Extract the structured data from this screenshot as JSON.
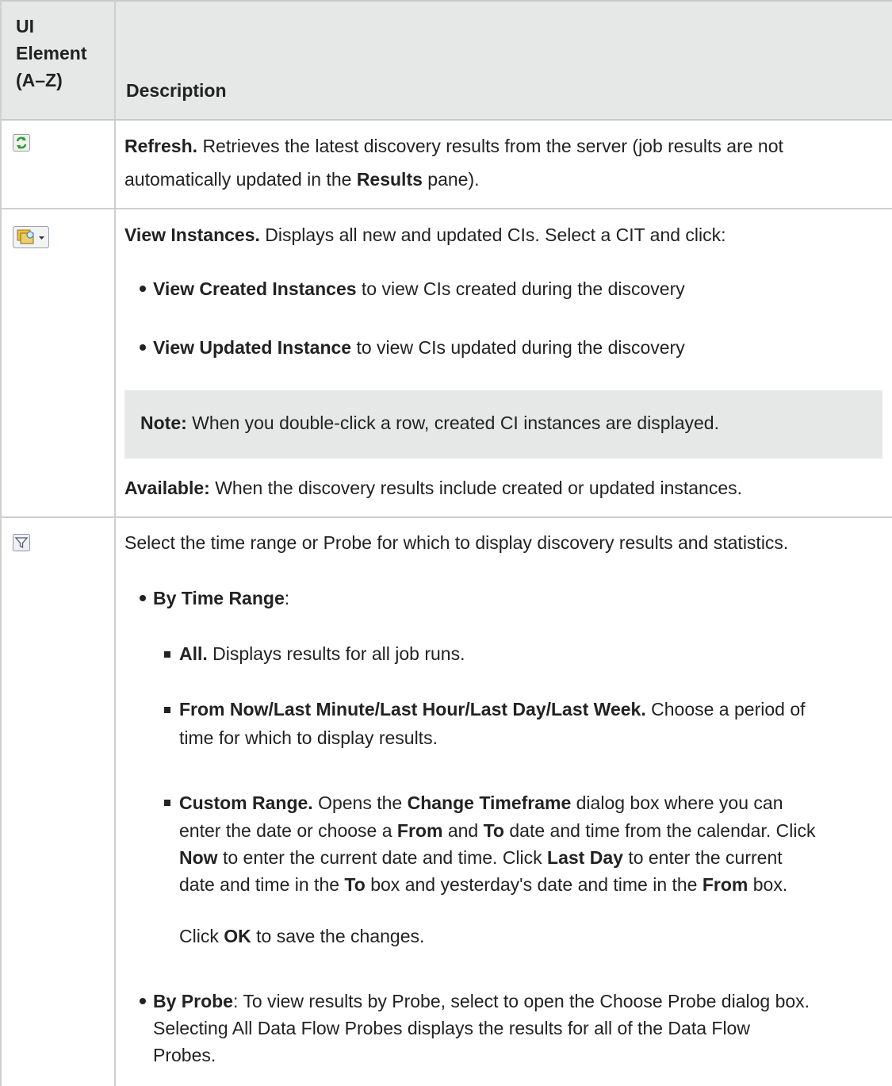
{
  "header": {
    "col1_lines": [
      "UI",
      "Element",
      "(A–Z)"
    ],
    "col2": "Description"
  },
  "rows": {
    "refresh": {
      "icon": "refresh-icon",
      "title": "Refresh.",
      "line1": "Retrieves the latest discovery results from the server (job results are not",
      "line2_pre": "automatically updated in the",
      "line2_bold": "Results",
      "line2_post": "pane)."
    },
    "view_instances": {
      "icon": "view-instances-icon",
      "title": "View Instances.",
      "line1": "Displays all new and updated CIs. Select a CIT and click:",
      "bullet1_bold": "View Created Instances",
      "bullet1_text": "to view CIs created during the discovery",
      "bullet2_bold": "View Updated Instance",
      "bullet2_text": "to view CIs updated during the discovery",
      "note_label": "Note:",
      "note_text": "When you double-click a row, created CI instances are displayed.",
      "available_label": "Available:",
      "available_text": "When the discovery results include created or updated instances."
    },
    "filter": {
      "icon": "filter-icon",
      "intro": "Select the time range or Probe for which to display discovery results and statistics.",
      "by_time_range": "By Time Range",
      "colon": ":",
      "all_bold": "All.",
      "all_text": "Displays results for all job runs.",
      "from_now_bold": "From Now/Last Minute/Last Hour/Last Day/Last Week.",
      "from_now_text1": "Choose a period of",
      "from_now_text2": "time for which to display results.",
      "custom_bold": "Custom Range.",
      "custom_l1_a": "Opens the",
      "custom_l1_b": "Change Timeframe",
      "custom_l1_c": "dialog box where you can",
      "custom_l2_a": "enter the date or choose a",
      "custom_l2_b": "From",
      "custom_l2_c": "and",
      "custom_l2_d": "To",
      "custom_l2_e": "date and time from the calendar. Click",
      "custom_l3_a": "Now",
      "custom_l3_b": "to enter the current date and time. Click",
      "custom_l3_c": "Last Day",
      "custom_l3_d": "to enter the current",
      "custom_l4_a": "date and time in the",
      "custom_l4_b": "To",
      "custom_l4_c": "box and yesterday's date and time in the",
      "custom_l4_d": "From",
      "custom_l4_e": "box.",
      "custom_l5_a": "Click",
      "custom_l5_b": "OK",
      "custom_l5_c": "to save the changes.",
      "by_probe": "By Probe",
      "probe_l1": ": To view results by Probe, select to open the Choose Probe dialog box.",
      "probe_l2": "Selecting All Data Flow Probes displays the results for all of the Data Flow",
      "probe_l3": "Probes."
    }
  },
  "colors": {
    "header_bg": "#e6e8e8",
    "note_bg": "#e6e8e8",
    "grid": "#cfcfcf",
    "text": "#222222"
  }
}
